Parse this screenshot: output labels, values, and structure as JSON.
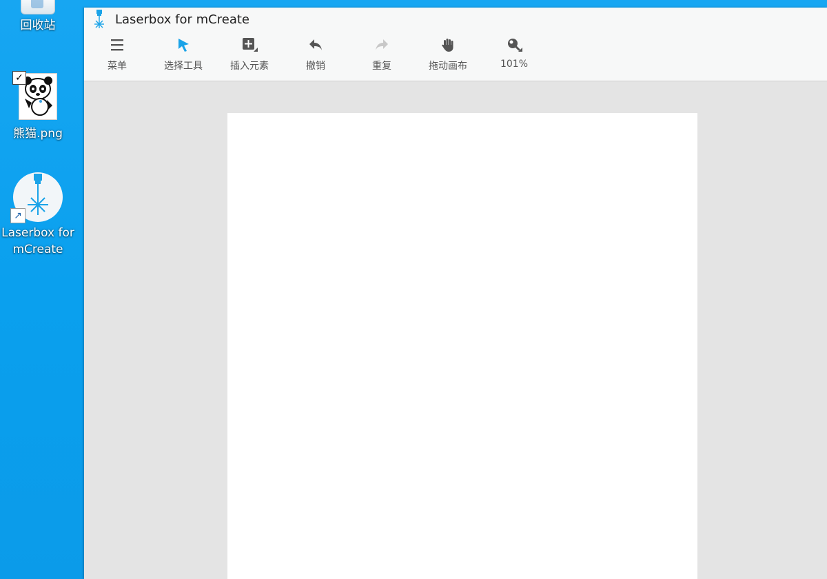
{
  "desktop": {
    "icons": [
      {
        "label": "回收站"
      },
      {
        "label": "熊猫.png"
      },
      {
        "label": "Laserbox for mCreate"
      }
    ]
  },
  "window": {
    "title": "Laserbox for mCreate"
  },
  "toolbar": {
    "items": [
      {
        "label": "菜单",
        "icon": "menu-icon"
      },
      {
        "label": "选择工具",
        "icon": "pointer-icon"
      },
      {
        "label": "插入元素",
        "icon": "insert-icon"
      },
      {
        "label": "撤销",
        "icon": "undo-icon"
      },
      {
        "label": "重复",
        "icon": "redo-icon"
      },
      {
        "label": "拖动画布",
        "icon": "hand-icon"
      },
      {
        "label": "101%",
        "icon": "zoom-icon"
      }
    ]
  },
  "colors": {
    "accent": "#1aa3e8",
    "icon": "#555555",
    "disabled_icon": "#c8c8c8"
  }
}
